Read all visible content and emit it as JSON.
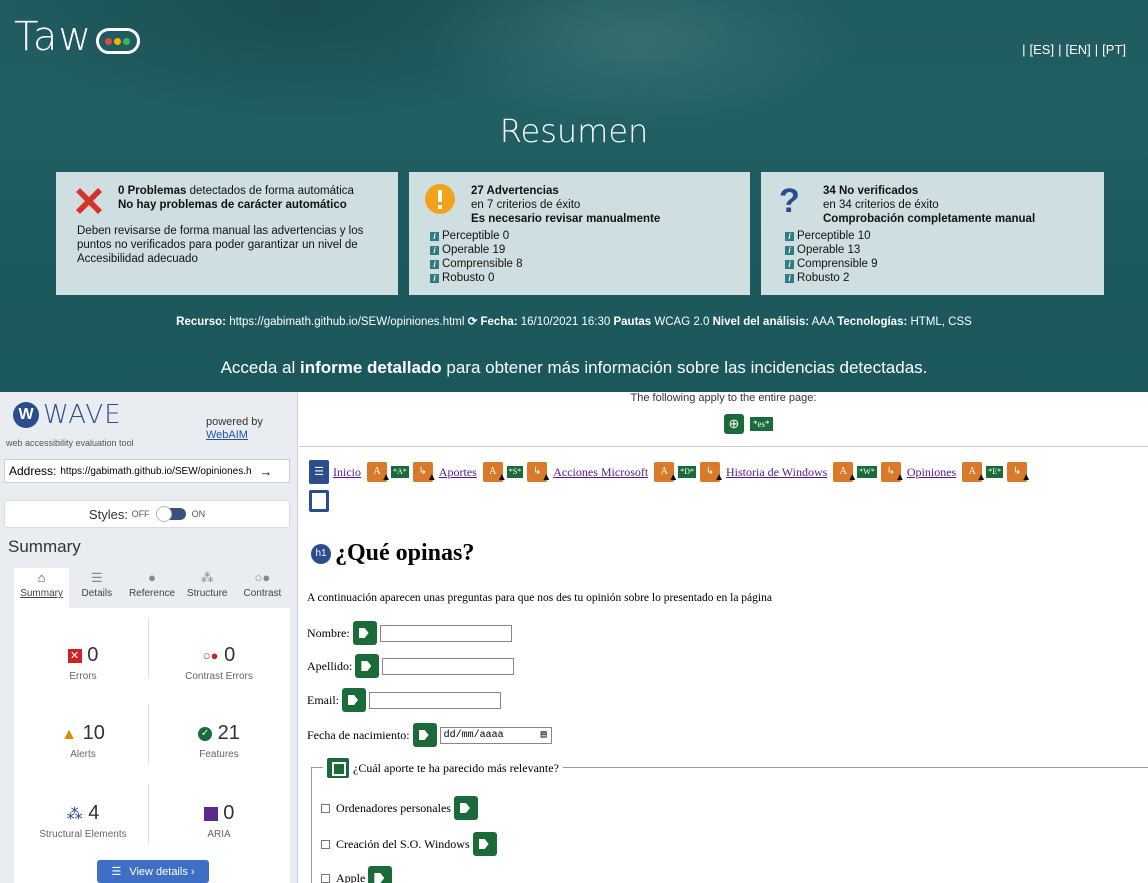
{
  "taw": {
    "logo": "Taw",
    "langs": [
      "[ES]",
      "[EN]",
      "[PT]"
    ],
    "title": "Resumen",
    "box1": {
      "l1_num": "0 Problemas",
      "l1_rest": " detectados de forma automática",
      "l2": "No hay problemas de carácter automático",
      "p": "Deben revisarse de forma manual las advertencias y los puntos no verificados para poder garantizar un nivel de Accesibilidad adecuado"
    },
    "box2": {
      "title": "27 Advertencias",
      "sub": "en 7 criterios de éxito",
      "bold": "Es necesario revisar manualmente",
      "items": [
        "Perceptible 0",
        "Operable 19",
        "Comprensible 8",
        "Robusto 0"
      ]
    },
    "box3": {
      "title": "34 No verificados",
      "sub": "en 34 criterios de éxito",
      "bold": "Comprobación completamente manual",
      "items": [
        "Perceptible 10",
        "Operable 13",
        "Comprensible 9",
        "Robusto 2"
      ]
    },
    "meta": {
      "recurso_lbl": "Recurso:",
      "recurso": " https://gabimath.github.io/SEW/opiniones.html ",
      "fecha_lbl": "Fecha:",
      "fecha": " 16/10/2021 16:30 ",
      "pautas_lbl": "Pautas",
      "pautas": " WCAG 2.0 ",
      "nivel_lbl": "Nivel del análisis:",
      "nivel": " AAA ",
      "tec_lbl": "Tecnologías:",
      "tec": " HTML, CSS"
    },
    "cta": {
      "pre": "Acceda al ",
      "bold": "informe detallado",
      "post": " para obtener más información sobre las incidencias detectadas."
    }
  },
  "wave": {
    "logo": "WAVE",
    "subtitle": "web accessibility evaluation tool",
    "powered": "powered by",
    "webaim": "WebAIM",
    "address_label": "Address:",
    "address": "https://gabimath.github.io/SEW/opiniones.h",
    "styles_label": "Styles:",
    "off": "OFF",
    "on": "ON",
    "summary_title": "Summary",
    "tabs": [
      "Summary",
      "Details",
      "Reference",
      "Structure",
      "Contrast"
    ],
    "stats": {
      "errors": {
        "num": "0",
        "label": "Errors"
      },
      "contrast": {
        "num": "0",
        "label": "Contrast Errors"
      },
      "alerts": {
        "num": "10",
        "label": "Alerts"
      },
      "features": {
        "num": "21",
        "label": "Features"
      },
      "structural": {
        "num": "4",
        "label": "Structural Elements"
      },
      "aria": {
        "num": "0",
        "label": "ARIA"
      }
    },
    "view_details": "View details ›"
  },
  "page": {
    "topnote": "The following apply to the entire page:",
    "lang_tag": "*es*",
    "nav": [
      {
        "label": "Inicio",
        "tag": "*A*"
      },
      {
        "label": "Aportes",
        "tag": "*S*"
      },
      {
        "label": "Acciones Microsoft",
        "tag": "*D*"
      },
      {
        "label": "Historia de Windows",
        "tag": "*W*"
      },
      {
        "label": "Opiniones",
        "tag": "*E*"
      }
    ],
    "h1_badge": "h1",
    "h1": "¿Qué opinas?",
    "intro": "A continuación aparecen unas preguntas para que nos des tu opinión sobre lo presentado en la página",
    "fields": {
      "nombre": "Nombre:",
      "apellido": "Apellido:",
      "email": "Email:",
      "fecha": "Fecha de nacimiento:",
      "date_placeholder": "dd/mm/aaaa"
    },
    "legend": "¿Cuál aporte te ha parecido más relevante?",
    "options": [
      "Ordenadores personales",
      "Creación del S.O. Windows",
      "Apple"
    ]
  },
  "colors": {
    "taw_bg": "#1f5b5f",
    "box_bg": "#cfdfe1",
    "wave_blue": "#2a4d8f",
    "wave_green": "#1b6b3a",
    "wave_orange": "#d9792a",
    "error_red": "#cc2222"
  }
}
